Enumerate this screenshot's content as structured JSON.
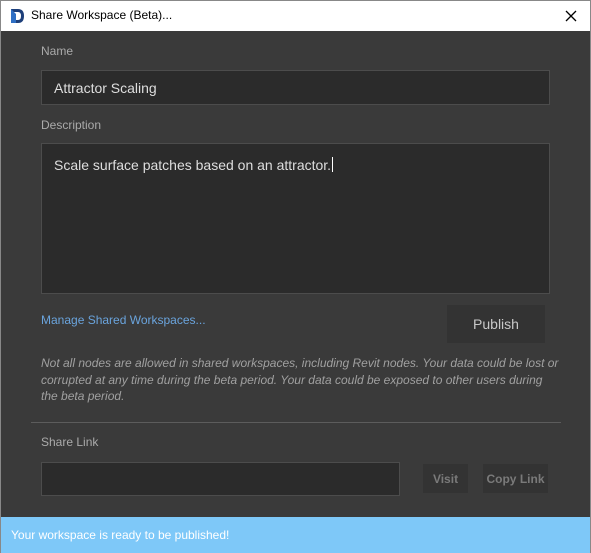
{
  "window": {
    "title": "Share Workspace (Beta)...",
    "app_icon": "dynamo-icon",
    "close_icon": "close-icon"
  },
  "form": {
    "name_label": "Name",
    "name_value": "Attractor Scaling",
    "description_label": "Description",
    "description_value": "Scale surface patches based on an attractor.",
    "manage_link": "Manage Shared Workspaces...",
    "publish_label": "Publish",
    "warning_text": "Not all nodes are allowed in shared workspaces, including Revit nodes. Your data could be lost or corrupted at any time during the beta period. Your data could be exposed to other users during the beta period."
  },
  "share": {
    "label": "Share Link",
    "link_value": "",
    "visit_label": "Visit",
    "copy_label": "Copy Link"
  },
  "status": {
    "message": "Your workspace is ready to be published!"
  },
  "colors": {
    "background": "#3a3a3a",
    "field": "#2b2b2b",
    "link": "#6aa4dd",
    "status_bar": "#7ec8f8"
  }
}
